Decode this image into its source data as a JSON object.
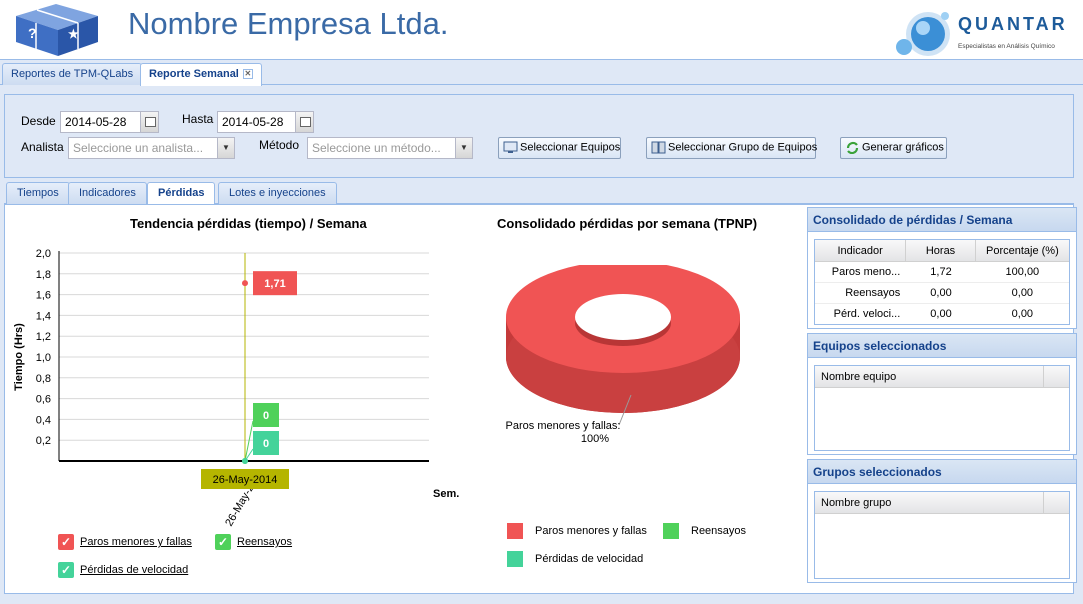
{
  "header": {
    "company": "Nombre Empresa Ltda.",
    "brand": "QUANTAR",
    "brand_tagline": "Especialistas en Análisis Químico"
  },
  "main_tabs": [
    {
      "label": "Reportes de TPM-QLabs"
    },
    {
      "label": "Reporte Semanal"
    }
  ],
  "filters": {
    "desde_label": "Desde",
    "desde_value": "2014-05-28",
    "hasta_label": "Hasta",
    "hasta_value": "2014-05-28",
    "analista_label": "Analista",
    "analista_placeholder": "Seleccione un analista...",
    "metodo_label": "Método",
    "metodo_placeholder": "Seleccione un método...",
    "btn_equipos": "Seleccionar Equipos",
    "btn_grupo": "Seleccionar Grupo de Equipos",
    "btn_graficos": "Generar gráficos"
  },
  "sub_tabs": [
    {
      "label": "Tiempos"
    },
    {
      "label": "Indicadores"
    },
    {
      "label": "Pérdidas"
    },
    {
      "label": "Lotes e inyecciones"
    }
  ],
  "colors": {
    "red": "#f05454",
    "green": "#4fd15a",
    "teal": "#44d39a",
    "olive": "#b5b500",
    "accent": "#15428b"
  },
  "chart_data": [
    {
      "type": "line",
      "title": "Tendencia pérdidas (tiempo) / Semana",
      "ylabel": "Tiempo (Hrs)",
      "xlabel": "Sem.",
      "x": [
        "26-May-2014"
      ],
      "x_tick": "26-May-2",
      "crosshair_label": "26-May-2014",
      "ylim": [
        0,
        2.0
      ],
      "yticks": [
        "2,0",
        "1,8",
        "1,6",
        "1,4",
        "1,2",
        "1,0",
        "0,8",
        "0,6",
        "0,4",
        "0,2"
      ],
      "series": [
        {
          "name": "Paros menores y fallas",
          "values": [
            1.71
          ],
          "label": "1,71",
          "color": "#f05454"
        },
        {
          "name": "Reensayos",
          "values": [
            0
          ],
          "label": "0",
          "color": "#4fd15a"
        },
        {
          "name": "Pérdidas de velocidad",
          "values": [
            0
          ],
          "label": "0",
          "color": "#44d39a"
        }
      ],
      "grid": true,
      "legend": "bottom-left"
    },
    {
      "type": "pie",
      "title": "Consolidado pérdidas por semana (TPNP)",
      "slices": [
        {
          "name": "Paros menores y fallas",
          "value": 100,
          "color": "#f05454"
        },
        {
          "name": "Reensayos",
          "value": 0,
          "color": "#4fd15a"
        },
        {
          "name": "Pérdidas de velocidad",
          "value": 0,
          "color": "#44d39a"
        }
      ],
      "slice_label_name": "Paros menores y fallas:",
      "slice_label_pct": "100%",
      "legend": "bottom"
    }
  ],
  "consolidado": {
    "title": "Consolidado de pérdidas / Semana",
    "columns": [
      "Indicador",
      "Horas",
      "Porcentaje (%)"
    ],
    "rows": [
      [
        "Paros meno...",
        "1,72",
        "100,00"
      ],
      [
        "Reensayos",
        "0,00",
        "0,00"
      ],
      [
        "Pérd. veloci...",
        "0,00",
        "0,00"
      ]
    ]
  },
  "equipos": {
    "title": "Equipos seleccionados",
    "column": "Nombre equipo"
  },
  "grupos": {
    "title": "Grupos seleccionados",
    "column": "Nombre grupo"
  }
}
